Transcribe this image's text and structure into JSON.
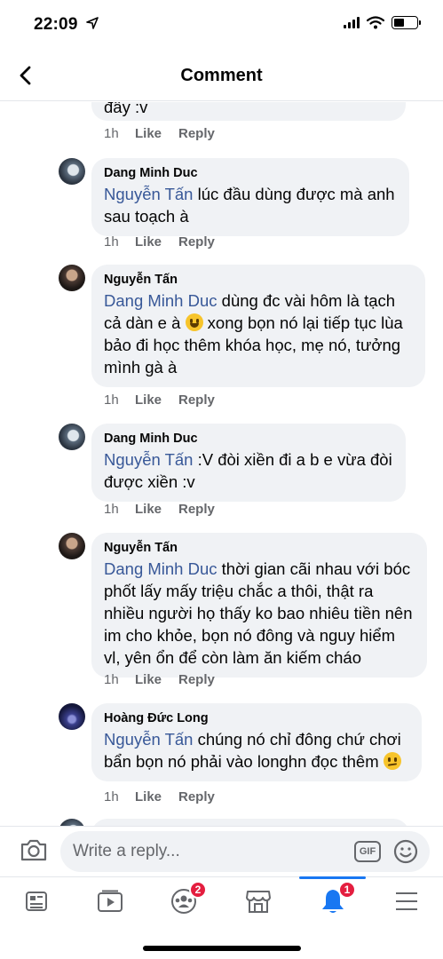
{
  "status": {
    "time": "22:09"
  },
  "nav": {
    "title": "Comment"
  },
  "comments": [
    {
      "text_tail": "đây :v",
      "time": "1h",
      "like": "Like",
      "reply": "Reply"
    },
    {
      "author": "Dang Minh Duc",
      "mention": "Nguyễn Tấn",
      "text": " lúc đầu dùng được mà anh sau toạch à",
      "time": "1h",
      "like": "Like",
      "reply": "Reply"
    },
    {
      "author": "Nguyễn Tấn",
      "mention": "Dang Minh Duc",
      "text": " dùng đc vài hôm là tạch cả dàn e à ",
      "text2": " xong bọn nó lại tiếp tục lùa bảo đi học thêm khóa học, mẹ nó, tưởng mình gà à",
      "time": "1h",
      "like": "Like",
      "reply": "Reply"
    },
    {
      "author": "Dang Minh Duc",
      "mention": "Nguyễn Tấn",
      "text": " :V đòi xiền đi a b e vừa đòi được xiền :v",
      "time": "1h",
      "like": "Like",
      "reply": "Reply"
    },
    {
      "author": "Nguyễn Tấn",
      "mention": "Dang Minh Duc",
      "text": " thời gian cãi nhau với bóc phốt lấy mấy triệu chắc a thôi, thật ra nhiều người họ thấy ko bao nhiêu tiền nên im cho khỏe, bọn nó đông và nguy hiểm vl, yên ổn để còn làm ăn kiếm cháo",
      "time": "1h",
      "like": "Like",
      "reply": "Reply"
    },
    {
      "author": "Hoàng Đức Long",
      "mention": "Nguyễn Tấn",
      "text": "  chúng nó chỉ đông chứ chơi bẩn bọn nó phải vào longhn đọc thêm ",
      "time": "1h",
      "like": "Like",
      "reply": "Reply"
    }
  ],
  "composer": {
    "placeholder": "Write a reply...",
    "gif_label": "GIF"
  },
  "tabbar": {
    "groups_badge": "2",
    "notifications_badge": "1",
    "active": "notifications",
    "accent": "#1877f2"
  }
}
